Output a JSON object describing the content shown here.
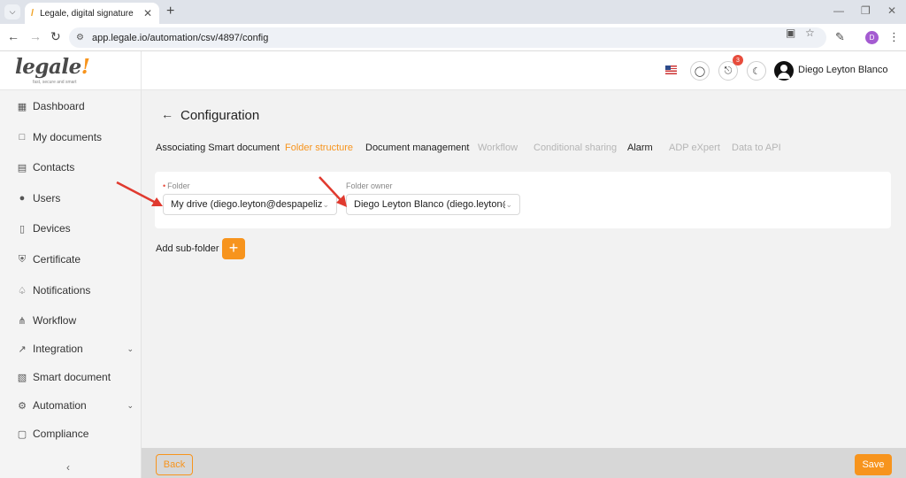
{
  "browser": {
    "tab_title": "Legale, digital signature",
    "url": "app.legale.io/automation/csv/4897/config",
    "profile_initial": "D"
  },
  "header": {
    "logo_text": "legale",
    "logo_mark": "!",
    "logo_tagline": "fast, secure and smart",
    "notification_count": "3",
    "user_name": "Diego Leyton Blanco"
  },
  "sidebar": {
    "items": [
      {
        "label": "Dashboard",
        "icon": "dashboard-icon"
      },
      {
        "label": "My documents",
        "icon": "folder-icon"
      },
      {
        "label": "Contacts",
        "icon": "contacts-icon"
      },
      {
        "label": "Users",
        "icon": "user-icon"
      },
      {
        "label": "Devices",
        "icon": "device-icon"
      },
      {
        "label": "Certificate",
        "icon": "shield-icon"
      },
      {
        "label": "Notifications",
        "icon": "bell-icon"
      },
      {
        "label": "Workflow",
        "icon": "workflow-icon"
      },
      {
        "label": "Integration",
        "icon": "external-link-icon"
      },
      {
        "label": "Smart document",
        "icon": "table-icon"
      },
      {
        "label": "Automation",
        "icon": "automation-icon"
      },
      {
        "label": "Compliance",
        "icon": "chat-icon"
      }
    ]
  },
  "main": {
    "title": "Configuration",
    "tabs": [
      {
        "label": "Associating Smart document",
        "state": "normal"
      },
      {
        "label": "Folder structure",
        "state": "active"
      },
      {
        "label": "Document management",
        "state": "normal"
      },
      {
        "label": "Workflow",
        "state": "disabled"
      },
      {
        "label": "Conditional sharing",
        "state": "disabled"
      },
      {
        "label": "Alarm",
        "state": "normal"
      },
      {
        "label": "ADP eXpert",
        "state": "disabled"
      },
      {
        "label": "Data to API",
        "state": "disabled"
      }
    ],
    "folder": {
      "label": "Folder",
      "value": "My drive (diego.leyton@despapeliza.i..."
    },
    "folder_owner": {
      "label": "Folder owner",
      "value": "Diego Leyton Blanco (diego.leyton@..."
    },
    "add_subfolder_label": "Add sub-folder"
  },
  "footer": {
    "back_label": "Back",
    "save_label": "Save"
  },
  "colors": {
    "accent": "#f7941d",
    "annotation_arrow": "#e03a2f",
    "badge": "#e74c3c"
  }
}
